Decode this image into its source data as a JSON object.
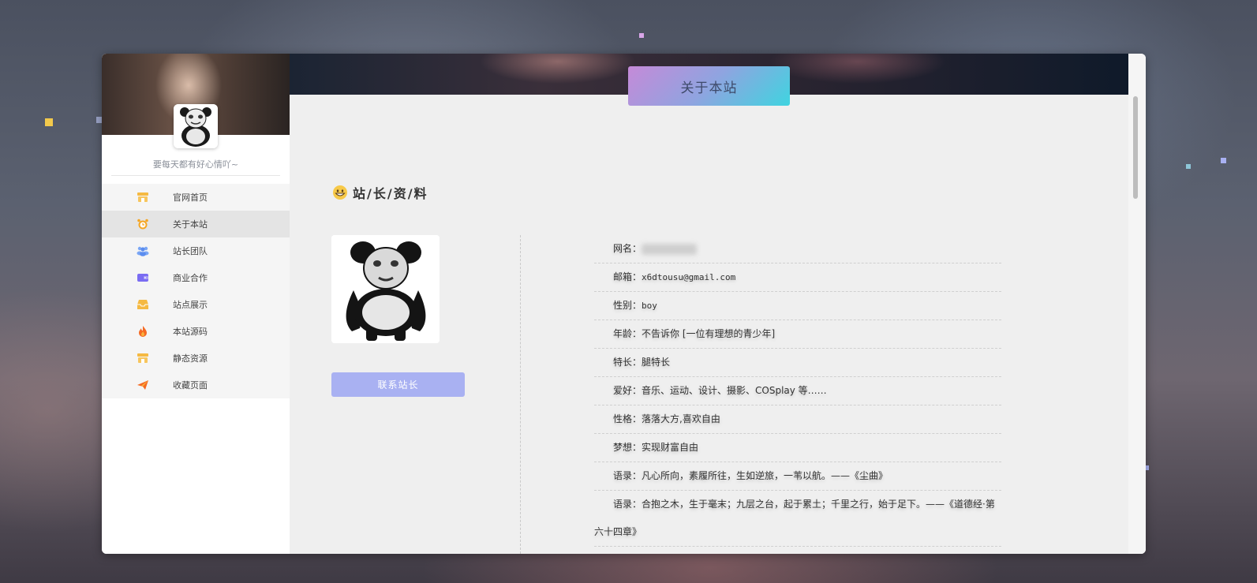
{
  "sidebar": {
    "motto": "要每天都有好心情吖~",
    "items": [
      {
        "label": "官网首页",
        "icon": "store-icon",
        "color": "#f5b942"
      },
      {
        "label": "关于本站",
        "icon": "alarm-clock-icon",
        "color": "#f5a623"
      },
      {
        "label": "站长团队",
        "icon": "team-icon",
        "color": "#5b8def"
      },
      {
        "label": "商业合作",
        "icon": "wallet-icon",
        "color": "#7a6cf2"
      },
      {
        "label": "站点展示",
        "icon": "inbox-icon",
        "color": "#f5b942"
      },
      {
        "label": "本站源码",
        "icon": "fire-icon",
        "color": "#f56a23"
      },
      {
        "label": "静态资源",
        "icon": "store-icon",
        "color": "#f5b942"
      },
      {
        "label": "收藏页面",
        "icon": "paper-plane-icon",
        "color": "#f56a23"
      }
    ]
  },
  "main": {
    "page_title": "关于本站",
    "section_title": "站/长/资/料",
    "contact_button": "联系站长",
    "info": [
      {
        "label": "网名：",
        "value": ""
      },
      {
        "label": "邮箱：",
        "value": "x6dtousu@gmail.com"
      },
      {
        "label": "性别：",
        "value": "boy"
      },
      {
        "label": "年龄：",
        "value": "不告诉你 [一位有理想的青少年]"
      },
      {
        "label": "特长：",
        "value": "腿特长"
      },
      {
        "label": "爱好：",
        "value": "音乐、运动、设计、摄影、COSplay 等……"
      },
      {
        "label": "性格：",
        "value": "落落大方,喜欢自由"
      },
      {
        "label": "梦想：",
        "value": "实现财富自由"
      },
      {
        "label": "语录：",
        "value": "凡心所向，素履所往，生如逆旅，一苇以航。——《尘曲》"
      },
      {
        "label": "语录：",
        "value": "合抱之木，生于毫末；九层之台，起于累土；千里之行，始于足下。——《道德经·第六十四章》"
      }
    ]
  },
  "colors": {
    "accent_button": "#a9b1f2",
    "title_gradient_start": "#c58ad8",
    "title_gradient_end": "#3fd4e0"
  }
}
